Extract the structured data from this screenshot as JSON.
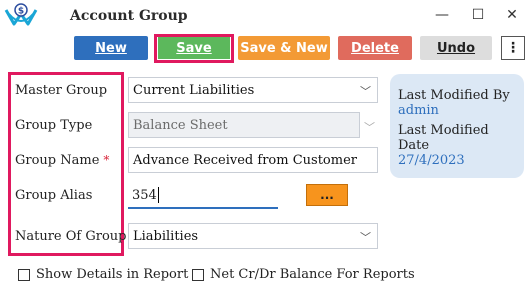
{
  "window": {
    "title": "Account Group",
    "minimize": "—",
    "maximize": "☐",
    "close": "✕"
  },
  "toolbar": {
    "new_label": "New",
    "save_label": "Save",
    "save_new_label": "Save & New",
    "delete_label": "Delete",
    "undo_label": "Undo",
    "more_label": "⋮"
  },
  "form": {
    "master_group": {
      "label": "Master Group",
      "value": "Current Liabilities"
    },
    "group_type": {
      "label": "Group Type",
      "value": "Balance Sheet"
    },
    "group_name": {
      "label": "Group Name",
      "required": "*",
      "value": "Advance Received from Customer"
    },
    "group_alias": {
      "label": "Group Alias",
      "value": "354",
      "lookup_label": "..."
    },
    "nature_of_group": {
      "label": "Nature Of Group",
      "value": "Liabilities"
    }
  },
  "info": {
    "last_modified_by_label": "Last Modified By",
    "last_modified_by": "admin",
    "last_modified_date_label": "Last Modified Date",
    "last_modified_date": "27/4/2023"
  },
  "options": {
    "show_details": "Show Details in Report",
    "net_balance": "Net Cr/Dr Balance For Reports"
  },
  "colors": {
    "accent": "#2e6fbd",
    "highlight": "#e0195f",
    "save": "#5cb85c",
    "save_new": "#f39a35",
    "delete": "#e06b5d"
  }
}
